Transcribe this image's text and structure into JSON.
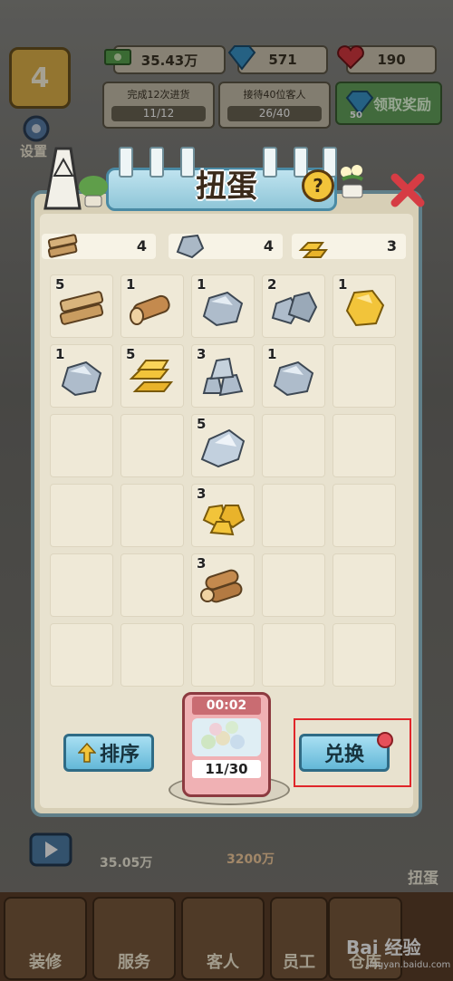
{
  "hud": {
    "level": "4",
    "money": "35.43万",
    "gems": "571",
    "hearts": "190",
    "tasks": [
      {
        "label": "完成12次进货",
        "progress": "11/12"
      },
      {
        "label": "接待40位客人",
        "progress": "26/40"
      }
    ],
    "claim": {
      "badge": "50",
      "label": "领取奖励"
    },
    "settings": "设置"
  },
  "dialog": {
    "title": "扭蛋",
    "help": "?",
    "summary": [
      {
        "icon": "wood-icon",
        "count": "4"
      },
      {
        "icon": "stone-icon",
        "count": "4"
      },
      {
        "icon": "gold-icon",
        "count": "3"
      }
    ],
    "items": [
      {
        "icon": "wood-plank",
        "count": "5"
      },
      {
        "icon": "log",
        "count": "1"
      },
      {
        "icon": "stone",
        "count": "1"
      },
      {
        "icon": "stones",
        "count": "2"
      },
      {
        "icon": "gold-nugget",
        "count": "1"
      },
      {
        "icon": "stone",
        "count": "1"
      },
      {
        "icon": "gold-bar",
        "count": "5"
      },
      {
        "icon": "stone-pile",
        "count": "3"
      },
      {
        "icon": "stone",
        "count": "1"
      },
      {
        "icon": "",
        "count": ""
      },
      {
        "icon": "",
        "count": ""
      },
      {
        "icon": "",
        "count": ""
      },
      {
        "icon": "crystal",
        "count": "5"
      },
      {
        "icon": "",
        "count": ""
      },
      {
        "icon": "",
        "count": ""
      },
      {
        "icon": "",
        "count": ""
      },
      {
        "icon": "",
        "count": ""
      },
      {
        "icon": "gold-nuggets",
        "count": "3"
      },
      {
        "icon": "",
        "count": ""
      },
      {
        "icon": "",
        "count": ""
      },
      {
        "icon": "",
        "count": ""
      },
      {
        "icon": "",
        "count": ""
      },
      {
        "icon": "logs",
        "count": "3"
      },
      {
        "icon": "",
        "count": ""
      },
      {
        "icon": "",
        "count": ""
      },
      {
        "icon": "",
        "count": ""
      },
      {
        "icon": "",
        "count": ""
      },
      {
        "icon": "",
        "count": ""
      },
      {
        "icon": "",
        "count": ""
      },
      {
        "icon": "",
        "count": ""
      }
    ],
    "sort_label": "排序",
    "exchange_label": "兑换",
    "machine": {
      "timer": "00:02",
      "count": "11/30"
    }
  },
  "bottom": {
    "money": "35.05万",
    "price": "3200万",
    "gacha_label": "扭蛋",
    "tabs": [
      "装修",
      "服务",
      "客人",
      "员工",
      "仓库"
    ],
    "watermark": "Bai 经验",
    "watermark_url": "jingyan.baidu.com"
  },
  "colors": {
    "panel_border": "#607f89",
    "highlight": "#e0262a",
    "button": "#64b8d8"
  }
}
